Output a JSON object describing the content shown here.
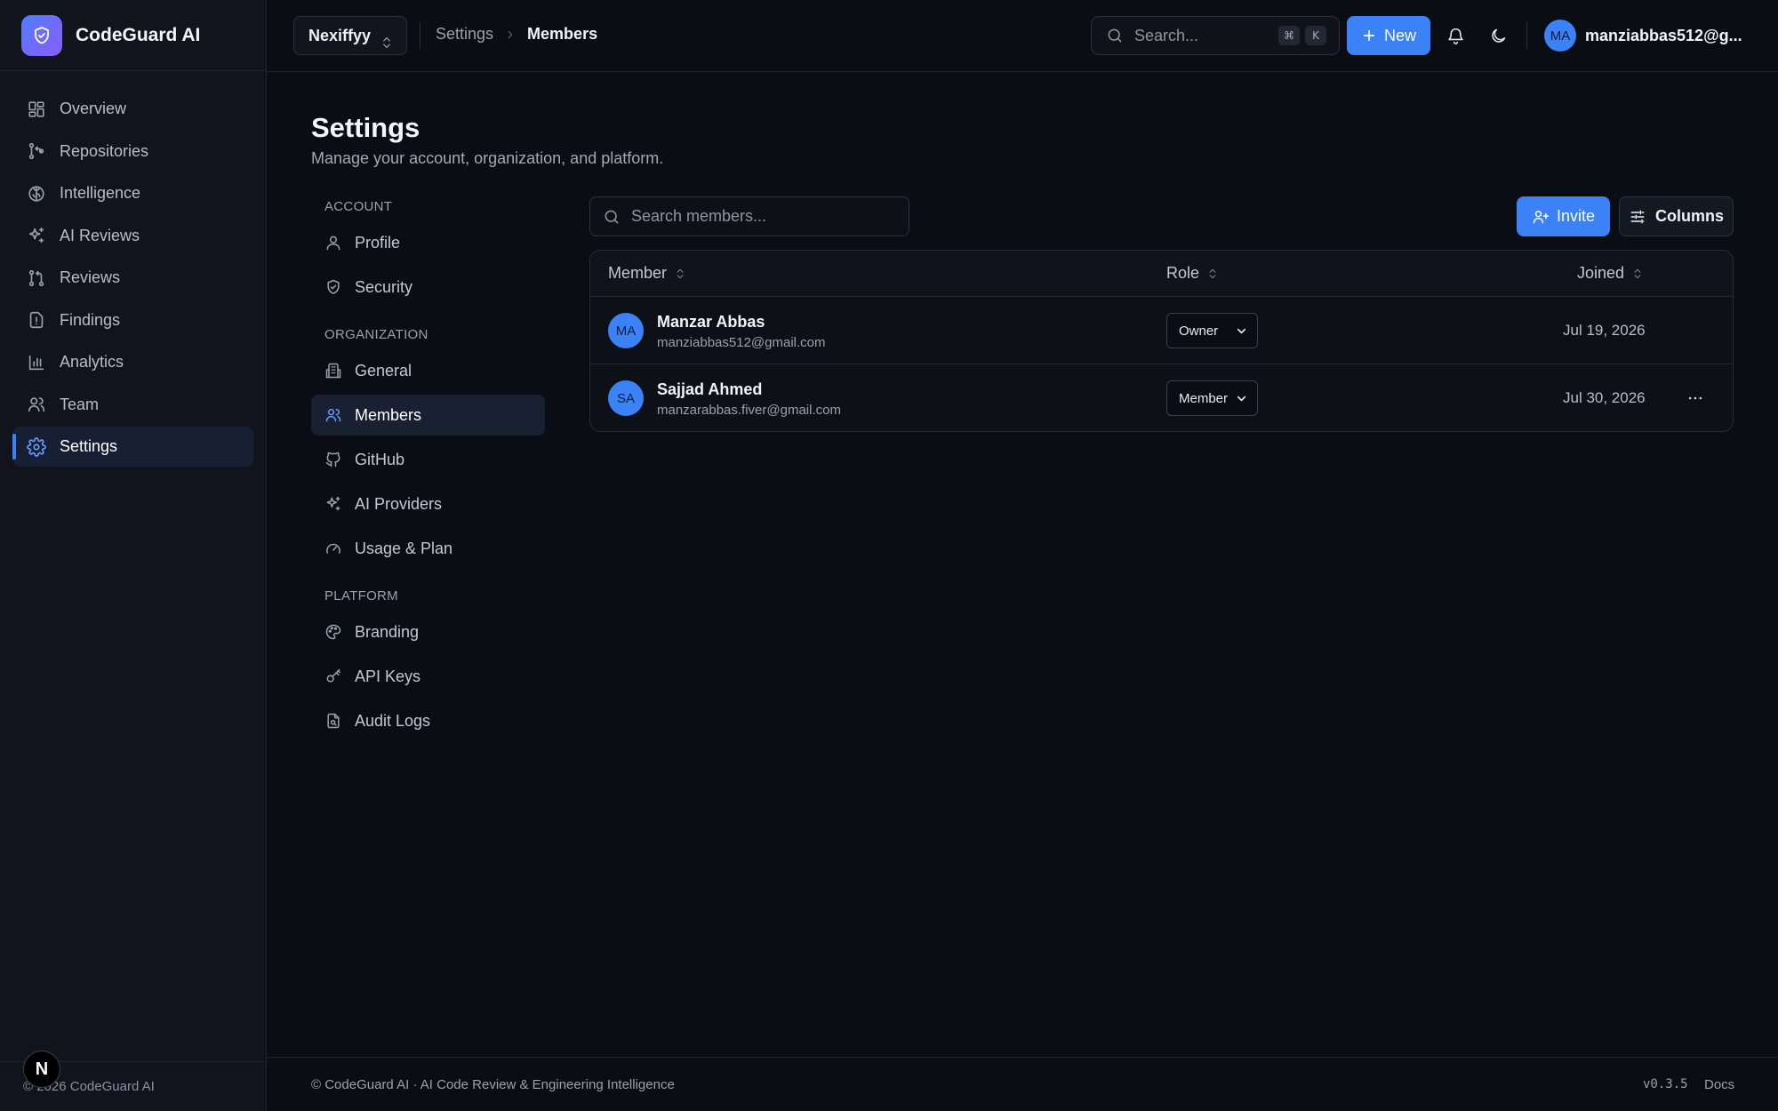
{
  "app": {
    "name": "CodeGuard AI"
  },
  "sidebar": {
    "items": [
      {
        "label": "Overview",
        "icon": "dashboard-icon"
      },
      {
        "label": "Repositories",
        "icon": "git-branch-icon"
      },
      {
        "label": "Intelligence",
        "icon": "brain-icon"
      },
      {
        "label": "AI Reviews",
        "icon": "sparkles-icon"
      },
      {
        "label": "Reviews",
        "icon": "git-pull-request-icon"
      },
      {
        "label": "Findings",
        "icon": "file-alert-icon"
      },
      {
        "label": "Analytics",
        "icon": "bar-chart-icon"
      },
      {
        "label": "Team",
        "icon": "users-icon"
      },
      {
        "label": "Settings",
        "icon": "gear-icon",
        "active": true
      }
    ],
    "footer": "© 2026 CodeGuard AI",
    "badge": "N"
  },
  "topbar": {
    "org": "Nexiffyy",
    "breadcrumb": {
      "parent": "Settings",
      "current": "Members"
    },
    "search": {
      "placeholder": "Search...",
      "shortcut": [
        "⌘",
        "K"
      ]
    },
    "new_label": "New",
    "user": {
      "initials": "MA",
      "name": "manziabbas512@g..."
    }
  },
  "page": {
    "title": "Settings",
    "subtitle": "Manage your account, organization, and platform."
  },
  "settings_nav": {
    "account": {
      "title": "ACCOUNT",
      "items": [
        {
          "label": "Profile",
          "icon": "user-icon"
        },
        {
          "label": "Security",
          "icon": "shield-check-icon"
        }
      ]
    },
    "organization": {
      "title": "ORGANIZATION",
      "items": [
        {
          "label": "General",
          "icon": "building-icon"
        },
        {
          "label": "Members",
          "icon": "users-icon",
          "active": true
        },
        {
          "label": "GitHub",
          "icon": "github-icon"
        },
        {
          "label": "AI Providers",
          "icon": "sparkles-icon"
        },
        {
          "label": "Usage & Plan",
          "icon": "gauge-icon"
        }
      ]
    },
    "platform": {
      "title": "PLATFORM",
      "items": [
        {
          "label": "Branding",
          "icon": "palette-icon"
        },
        {
          "label": "API Keys",
          "icon": "key-icon"
        },
        {
          "label": "Audit Logs",
          "icon": "file-search-icon"
        }
      ]
    }
  },
  "members": {
    "search": {
      "placeholder": "Search members..."
    },
    "invite_label": "Invite",
    "columns_label": "Columns",
    "headers": {
      "member": "Member",
      "role": "Role",
      "joined": "Joined"
    },
    "rows": [
      {
        "initials": "MA",
        "name": "Manzar Abbas",
        "email": "manziabbas512@gmail.com",
        "role": "Owner",
        "joined": "Jul 19, 2026"
      },
      {
        "initials": "SA",
        "name": "Sajjad Ahmed",
        "email": "manzarabbas.fiver@gmail.com",
        "role": "Member",
        "joined": "Jul 30, 2026"
      }
    ]
  },
  "footer": {
    "text": "© CodeGuard AI · AI Code Review & Engineering Intelligence",
    "version": "v0.3.5",
    "docs": "Docs"
  },
  "colors": {
    "background": "#0b0d14",
    "sidebar": "#11141c",
    "accent": "#3b82f6",
    "brand_gradient_start": "#4f7dff",
    "brand_gradient_end": "#8b5cf6"
  }
}
